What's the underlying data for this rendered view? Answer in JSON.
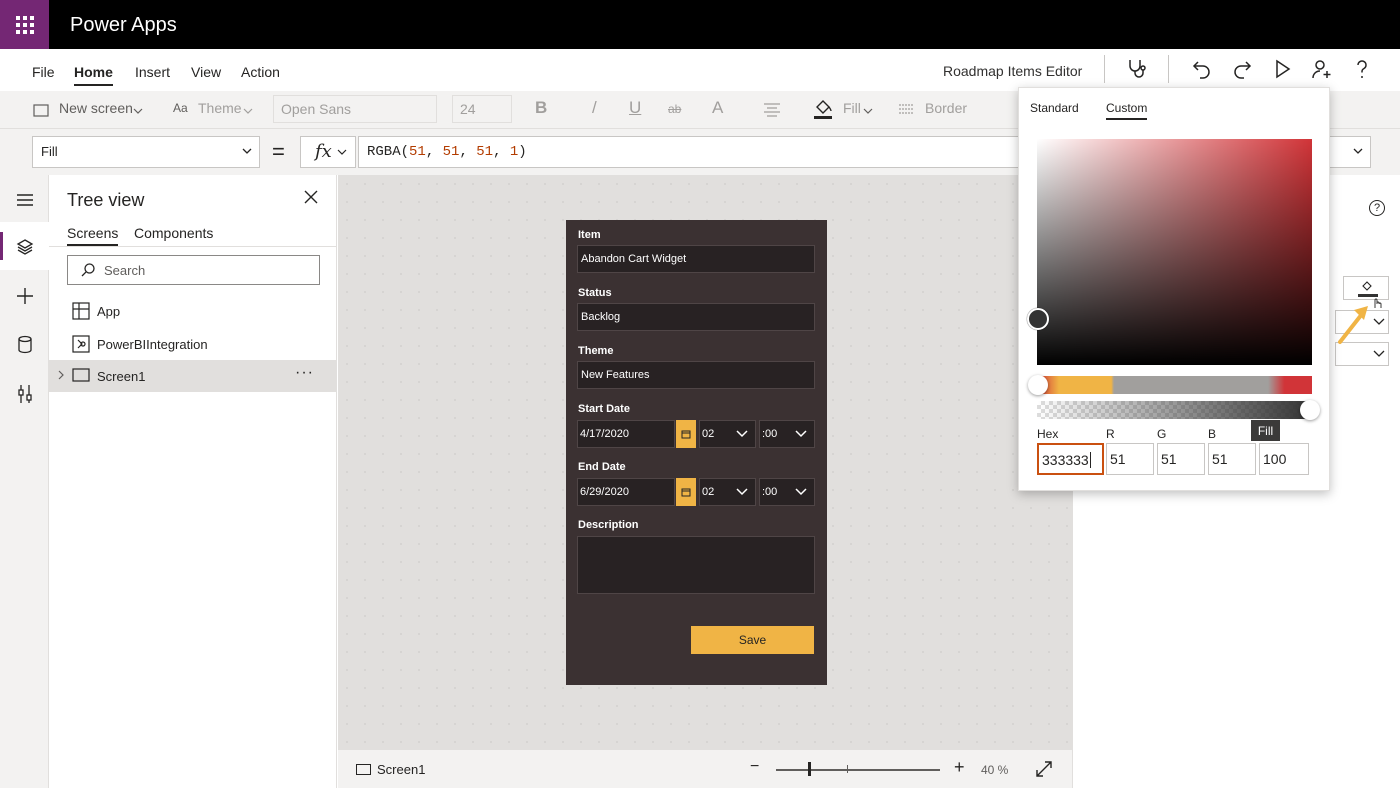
{
  "app": {
    "title": "Power Apps",
    "name": "Roadmap Items Editor"
  },
  "menu": [
    {
      "label": "File",
      "active": false
    },
    {
      "label": "Home",
      "active": true
    },
    {
      "label": "Insert",
      "active": false
    },
    {
      "label": "View",
      "active": false
    },
    {
      "label": "Action",
      "active": false
    }
  ],
  "toolbar_icons": [
    "stethoscope-icon",
    "undo-icon",
    "redo-icon",
    "play-icon",
    "share-user-icon",
    "help-icon"
  ],
  "ribbon": {
    "new_screen": "New screen",
    "theme": "Theme",
    "font": "Open Sans",
    "font_size": "24",
    "bold": "B",
    "italic": "/",
    "underline": "U",
    "strikethrough": "ab",
    "font_color": "A",
    "fill": "Fill",
    "border": "Border"
  },
  "formula": {
    "property": "Fill",
    "equals": "=",
    "fx": "fx",
    "func": "RGBA(",
    "r": "51",
    "g": "51",
    "b": "51",
    "a": "1",
    "close": ")",
    "sep": ", "
  },
  "tree": {
    "title": "Tree view",
    "tabs": [
      {
        "label": "Screens",
        "active": true
      },
      {
        "label": "Components",
        "active": false
      }
    ],
    "search_placeholder": "Search",
    "items": [
      {
        "label": "App"
      },
      {
        "label": "PowerBIIntegration"
      },
      {
        "label": "Screen1",
        "selected": true,
        "more": "···"
      }
    ]
  },
  "phone": {
    "fields": [
      {
        "label": "Item",
        "value": "Abandon Cart Widget"
      },
      {
        "label": "Status",
        "value": "Backlog"
      },
      {
        "label": "Theme",
        "value": "New Features"
      }
    ],
    "start": {
      "label": "Start Date",
      "date": "4/17/2020",
      "hour": "02",
      "minute": ":00"
    },
    "end": {
      "label": "End Date",
      "date": "6/29/2020",
      "hour": "02",
      "minute": ":00"
    },
    "description_label": "Description",
    "save_label": "Save",
    "colors": {
      "background": "#3b3132",
      "accent": "#f0b445",
      "input": "#282223"
    }
  },
  "bottom": {
    "screen_tab": "Screen1",
    "zoom_minus": "−",
    "zoom_plus": "+",
    "zoom": "40 %",
    "zoom_level": 0.4
  },
  "color_picker": {
    "tabs": [
      {
        "label": "Standard",
        "active": false
      },
      {
        "label": "Custom",
        "active": true
      }
    ],
    "hex_label": "Hex",
    "hex": "333333",
    "r_label": "R",
    "r": "51",
    "g_label": "G",
    "g": "51",
    "b_label": "B",
    "b": "51",
    "alpha": "100",
    "selected_color": "#333333"
  },
  "tooltip": "Fill",
  "help_glyph": "?"
}
